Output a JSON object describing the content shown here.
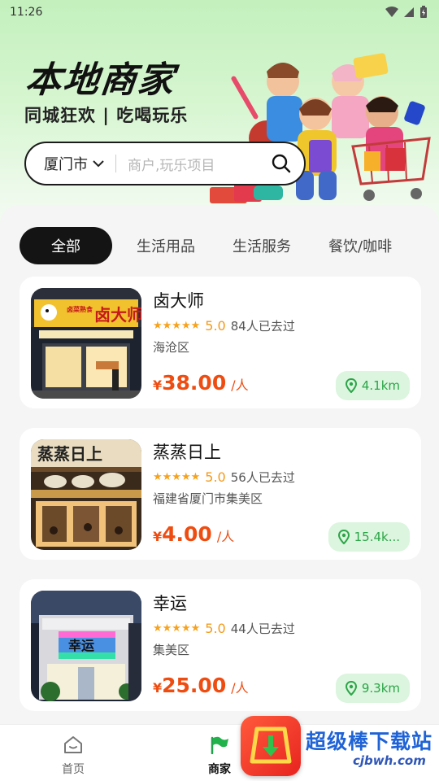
{
  "status_bar": {
    "time": "11:26"
  },
  "header": {
    "title": "本地商家",
    "subtitle": "同城狂欢 | 吃喝玩乐"
  },
  "search": {
    "city": "厦门市",
    "placeholder": "商户,玩乐项目"
  },
  "tabs": [
    {
      "label": "全部",
      "active": true
    },
    {
      "label": "生活用品",
      "active": false
    },
    {
      "label": "生活服务",
      "active": false
    },
    {
      "label": "餐饮/咖啡",
      "active": false
    }
  ],
  "stores": [
    {
      "name": "卤大师",
      "rating": "5.0",
      "stars": 5,
      "visited": "84人已去过",
      "area": "海沧区",
      "currency": "¥",
      "price": "38.00",
      "per": "/人",
      "distance": "4.1km",
      "sign": "卤大师",
      "sign_prefix": "卤菜熟食"
    },
    {
      "name": "蒸蒸日上",
      "rating": "5.0",
      "stars": 5,
      "visited": "56人已去过",
      "area": "福建省厦门市集美区",
      "currency": "¥",
      "price": "4.00",
      "per": "/人",
      "distance": "15.4k...",
      "sign": "蒸蒸日上"
    },
    {
      "name": "幸运",
      "rating": "5.0",
      "stars": 5,
      "visited": "44人已去过",
      "area": "集美区",
      "currency": "¥",
      "price": "25.00",
      "per": "/人",
      "distance": "9.3km",
      "sign": "幸运"
    }
  ],
  "tabbar": {
    "home": "首页",
    "merchants": "商家"
  },
  "watermark": {
    "text": "超级棒下载站",
    "url": "cjbwh.com"
  },
  "colors": {
    "accent_price": "#ee4d12",
    "rating": "#f39a1a",
    "distance_bg": "#dbf5de",
    "distance_text": "#2ca548",
    "hero_green": "#c3f0bd"
  }
}
